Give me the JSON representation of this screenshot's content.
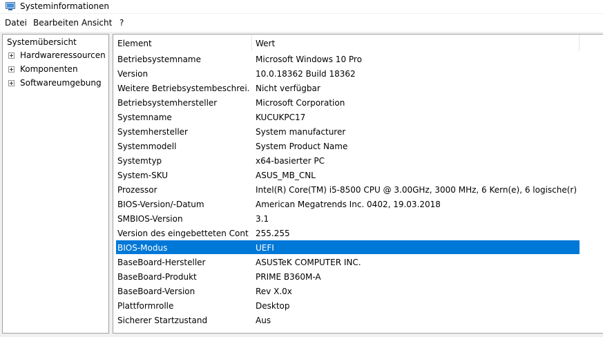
{
  "window": {
    "title": "Systeminformationen"
  },
  "menu": [
    "Datei",
    "Bearbeiten",
    "Ansicht",
    "?"
  ],
  "tree": {
    "root": "Systemübersicht",
    "items": [
      "Hardwareressourcen",
      "Komponenten",
      "Softwareumgebung"
    ]
  },
  "table": {
    "columns": [
      "Element",
      "Wert"
    ],
    "rows": [
      {
        "element": "Betriebsystemname",
        "value": "Microsoft Windows 10 Pro"
      },
      {
        "element": "Version",
        "value": "10.0.18362 Build 18362"
      },
      {
        "element": "Weitere Betriebsystembeschrei...",
        "value": "Nicht verfügbar"
      },
      {
        "element": "Betriebsystemhersteller",
        "value": "Microsoft Corporation"
      },
      {
        "element": "Systemname",
        "value": "KUCUKPC17"
      },
      {
        "element": "Systemhersteller",
        "value": "System manufacturer"
      },
      {
        "element": "Systemmodell",
        "value": "System Product Name"
      },
      {
        "element": "Systemtyp",
        "value": "x64-basierter PC"
      },
      {
        "element": "System-SKU",
        "value": "ASUS_MB_CNL"
      },
      {
        "element": "Prozessor",
        "value": "Intel(R) Core(TM) i5-8500 CPU @ 3.00GHz, 3000 MHz, 6 Kern(e), 6 logische(r) ..."
      },
      {
        "element": "BIOS-Version/-Datum",
        "value": "American Megatrends Inc. 0402, 19.03.2018"
      },
      {
        "element": "SMBIOS-Version",
        "value": "3.1"
      },
      {
        "element": "Version des eingebetteten Cont...",
        "value": "255.255"
      },
      {
        "element": "BIOS-Modus",
        "value": "UEFI"
      },
      {
        "element": "BaseBoard-Hersteller",
        "value": "ASUSTeK COMPUTER INC."
      },
      {
        "element": "BaseBoard-Produkt",
        "value": "PRIME B360M-A"
      },
      {
        "element": "BaseBoard-Version",
        "value": "Rev X.0x"
      },
      {
        "element": "Plattformrolle",
        "value": "Desktop"
      },
      {
        "element": "Sicherer Startzustand",
        "value": "Aus"
      }
    ],
    "selected_index": 13
  },
  "colors": {
    "selection": "#0078d7",
    "border": "#a0a0a0",
    "background": "#f0f0f0"
  },
  "icons": {
    "app": "system-information-icon",
    "expander": "plus-box-icon"
  }
}
